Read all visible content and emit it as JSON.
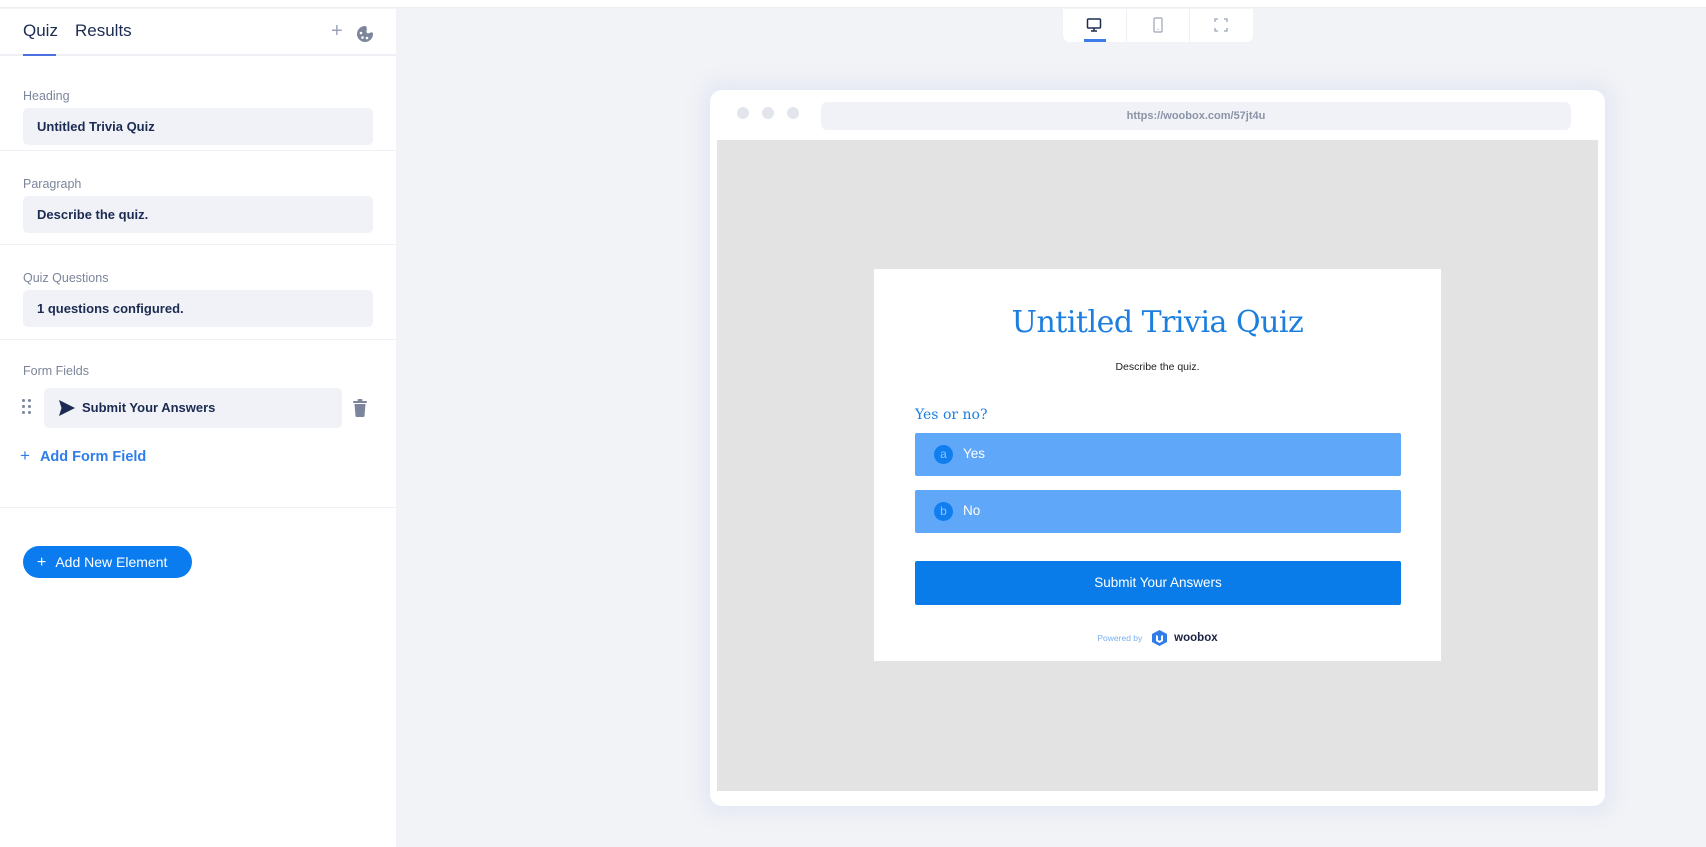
{
  "sidebar": {
    "tabs": [
      {
        "label": "Quiz",
        "active": true
      },
      {
        "label": "Results",
        "active": false
      }
    ],
    "sections": {
      "heading": {
        "label": "Heading",
        "value": "Untitled Trivia Quiz"
      },
      "paragraph": {
        "label": "Paragraph",
        "value": "Describe the quiz."
      },
      "questions": {
        "label": "Quiz Questions",
        "value": "1 questions configured."
      },
      "form_fields": {
        "label": "Form Fields",
        "items": [
          {
            "label": "Submit Your Answers",
            "icon": "send-icon"
          }
        ],
        "add_label": "Add Form Field"
      }
    },
    "add_element_label": "Add New Element",
    "plus_glyph": "+"
  },
  "device_toolbar": {
    "buttons": [
      {
        "name": "desktop",
        "icon": "desktop-icon",
        "active": true
      },
      {
        "name": "mobile",
        "icon": "mobile-icon",
        "active": false
      },
      {
        "name": "fullscreen",
        "icon": "fullscreen-icon",
        "active": false
      }
    ]
  },
  "preview": {
    "url": "https://woobox.com/57jt4u",
    "title": "Untitled Trivia Quiz",
    "description": "Describe the quiz.",
    "question": "Yes or no?",
    "answers": [
      {
        "letter": "a",
        "text": "Yes"
      },
      {
        "letter": "b",
        "text": "No"
      }
    ],
    "submit_label": "Submit Your Answers",
    "powered_by": "Powered by",
    "brand": "woobox"
  },
  "colors": {
    "accent": "#0a7cf0",
    "answer_bg": "#5ea7f9",
    "title": "#1c7fe0",
    "text_dark": "#1b2b52"
  }
}
